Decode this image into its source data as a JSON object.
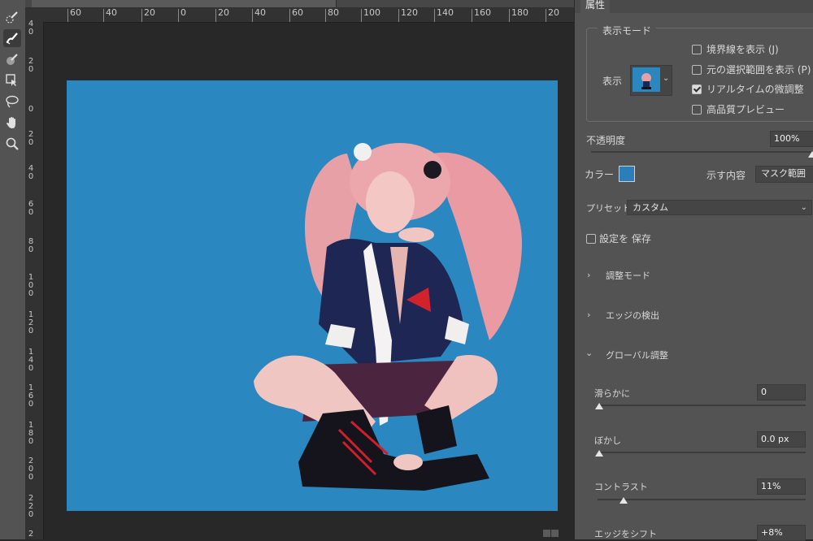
{
  "toolbar": {
    "tools": [
      {
        "icon": "quick-selection-brush-icon"
      },
      {
        "icon": "refine-edge-brush-icon",
        "active": true
      },
      {
        "icon": "brush-icon"
      },
      {
        "icon": "object-selection-icon"
      },
      {
        "icon": "lasso-icon"
      },
      {
        "icon": "hand-icon"
      },
      {
        "icon": "zoom-icon"
      }
    ]
  },
  "ruler": {
    "horizontal": [
      "60",
      "40",
      "20",
      "0",
      "20",
      "40",
      "60",
      "80",
      "100",
      "120",
      "140",
      "160",
      "180",
      "20"
    ],
    "vertical": [
      [
        "4",
        "0"
      ],
      [
        "2",
        "0"
      ],
      [
        "0"
      ],
      [
        "2",
        "0"
      ],
      [
        "4",
        "0"
      ],
      [
        "6",
        "0"
      ],
      [
        "8",
        "0"
      ],
      [
        "1",
        "0",
        "0"
      ],
      [
        "1",
        "2",
        "0"
      ],
      [
        "1",
        "4",
        "0"
      ],
      [
        "1",
        "6",
        "0"
      ],
      [
        "1",
        "8",
        "0"
      ],
      [
        "2",
        "0",
        "0"
      ],
      [
        "2",
        "2",
        "0"
      ],
      [
        "2"
      ]
    ]
  },
  "canvas": {
    "background": "#2a87bf"
  },
  "panel": {
    "tab_label": "属性",
    "view_mode": {
      "group_title": "表示モード",
      "view_label": "表示",
      "options": [
        {
          "label": "境界線を表示 (J)",
          "checked": false
        },
        {
          "label": "元の選択範囲を表示 (P)",
          "checked": false
        },
        {
          "label": "リアルタイムの微調整",
          "checked": true
        },
        {
          "label": "高品質プレビュー",
          "checked": false
        }
      ]
    },
    "opacity": {
      "label": "不透明度",
      "value": "100%",
      "level": 1.0
    },
    "color": {
      "label": "カラー",
      "swatch": "#2a7fb8",
      "show_label": "示す内容",
      "show_value": "マスク範囲"
    },
    "preset": {
      "label": "プリセット",
      "value": "カスタム"
    },
    "save_settings": {
      "label": "設定を 保存",
      "checked": false
    },
    "sections": {
      "adjust_mode": "調整モード",
      "edge_detect": "エッジの検出",
      "global_adjust": "グローバル調整"
    },
    "global": {
      "smooth": {
        "label": "滑らかに",
        "value": "0",
        "level": 0.0
      },
      "feather": {
        "label": "ぼかし",
        "value": "0.0 px",
        "level": 0.0
      },
      "contrast": {
        "label": "コントラスト",
        "value": "11%",
        "level": 0.11
      },
      "shift_edge": {
        "label": "エッジをシフト",
        "value": "+8%"
      }
    }
  }
}
